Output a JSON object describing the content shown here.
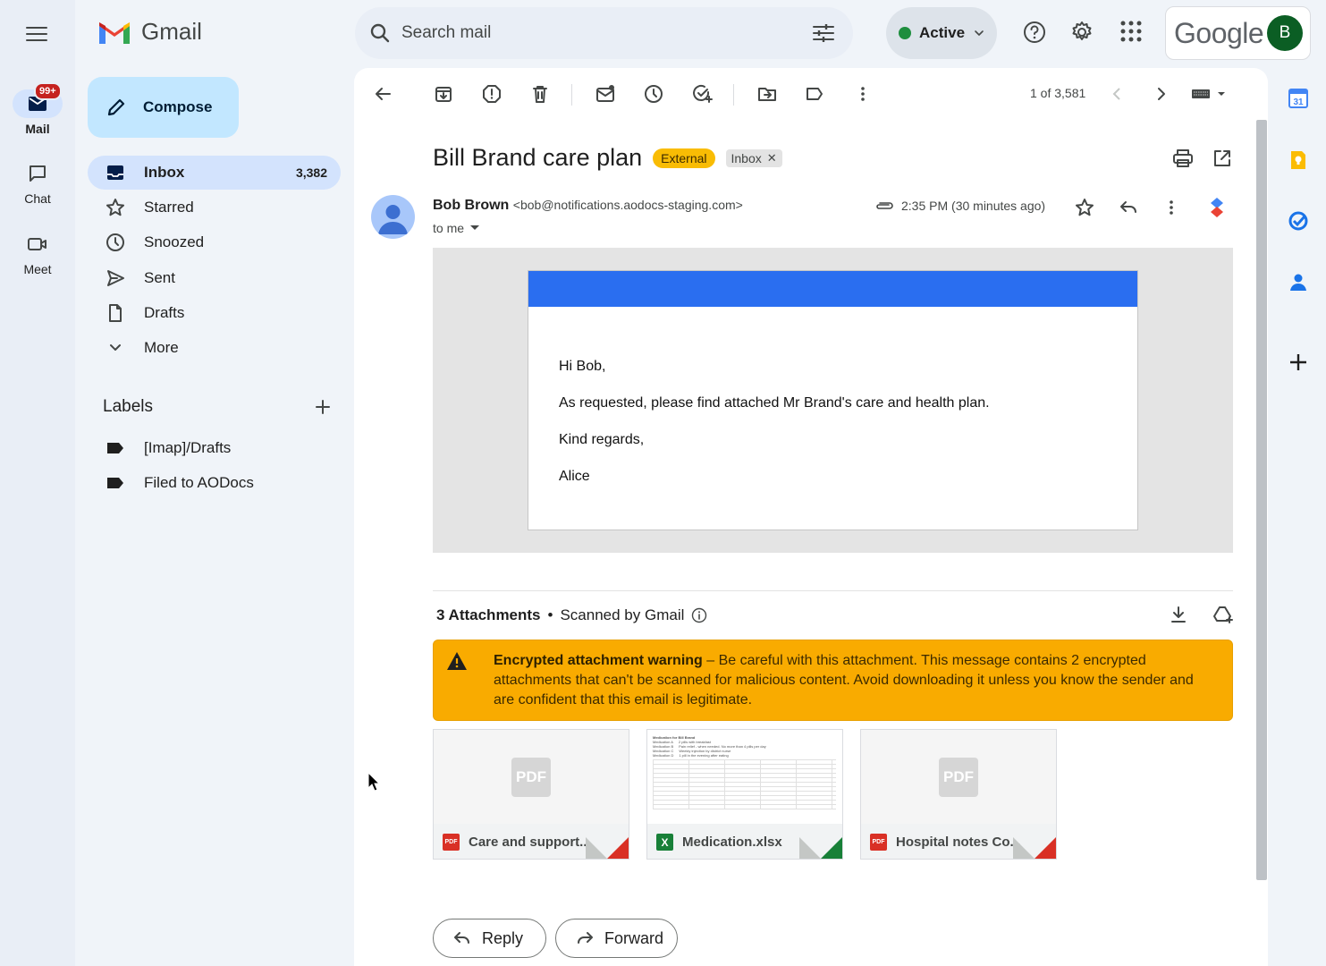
{
  "rail": {
    "mail_label": "Mail",
    "mail_badge": "99+",
    "chat_label": "Chat",
    "meet_label": "Meet"
  },
  "app": {
    "name": "Gmail"
  },
  "compose_label": "Compose",
  "nav": [
    {
      "label": "Inbox",
      "count": "3,382",
      "icon": "inbox-icon"
    },
    {
      "label": "Starred",
      "icon": "star-icon"
    },
    {
      "label": "Snoozed",
      "icon": "clock-icon"
    },
    {
      "label": "Sent",
      "icon": "send-icon"
    },
    {
      "label": "Drafts",
      "icon": "draft-icon"
    },
    {
      "label": "More",
      "icon": "chevron-down-icon"
    }
  ],
  "labels": {
    "heading": "Labels",
    "items": [
      "[Imap]/Drafts",
      "Filed to AODocs"
    ]
  },
  "search": {
    "placeholder": "Search mail"
  },
  "status": {
    "label": "Active",
    "color": "#1e8e3e"
  },
  "account": {
    "brand": "Google",
    "initial": "B"
  },
  "toolbar": {
    "pager": "1 of 3,581"
  },
  "email": {
    "subject": "Bill Brand care plan",
    "tag_external": "External",
    "tag_inbox": "Inbox",
    "sender_name": "Bob Brown",
    "sender_email": "<bob@notifications.aodocs-staging.com>",
    "recipient": "to me",
    "time": "2:35 PM (30 minutes ago)",
    "body": {
      "greeting": "Hi Bob,",
      "line1": "As requested, please find attached Mr Brand's care and health plan.",
      "line2": "Kind regards,",
      "signature": "Alice"
    }
  },
  "attachments": {
    "count_label": "3 Attachments",
    "scanned_label": "Scanned by Gmail",
    "warning_title": "Encrypted attachment warning",
    "warning_text": " – Be careful with this attachment. This message contains 2 encrypted attachments that can't be scanned for malicious content. Avoid downloading it unless you know the sender and are confident that this email is legitimate.",
    "files": [
      {
        "name": "Care and support...",
        "type": "PDF"
      },
      {
        "name": "Medication.xlsx",
        "type": "X"
      },
      {
        "name": "Hospital notes Co...",
        "type": "PDF"
      }
    ],
    "sheet_preview": {
      "title": "Medication for Bill Brand",
      "rows": [
        [
          "Medication A",
          "2 pills with breakfast"
        ],
        [
          "Medication B",
          "Pain relief - when needed. No more than 4 pills per day"
        ],
        [
          "Medication C",
          "Weekly injection by district nurse"
        ],
        [
          "Medication D",
          "1 pill in the evening after eating"
        ]
      ]
    }
  },
  "actions": {
    "reply": "Reply",
    "forward": "Forward"
  },
  "colors": {
    "accent": "#0b57d0",
    "warning": "#f9ab00",
    "external_tag": "#f9bc04",
    "email_banner": "#2a6ef0"
  }
}
